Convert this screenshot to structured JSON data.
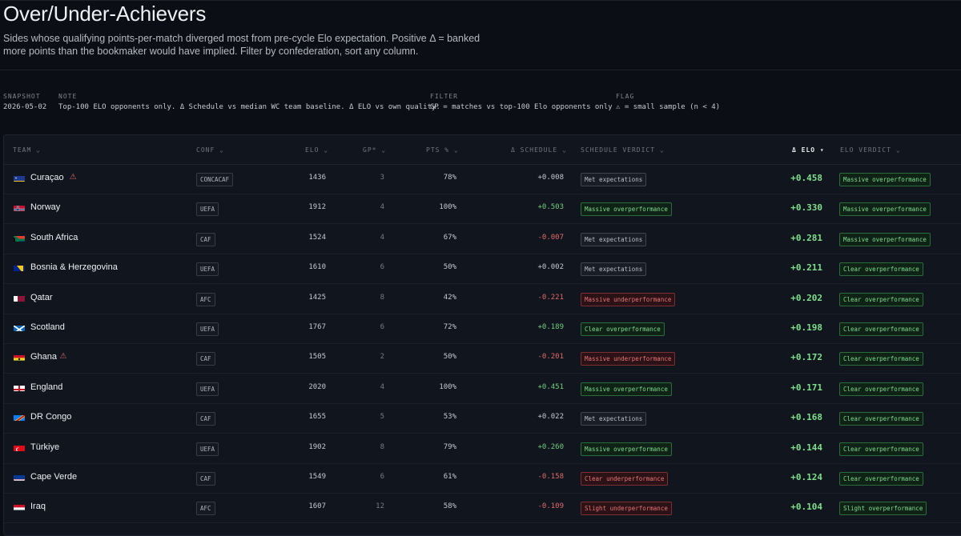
{
  "header": {
    "title": "Over/Under-Achievers",
    "subtitle": "Sides whose qualifying points-per-match diverged most from pre-cycle Elo expectation. Positive Δ = banked more points than the bookmaker would have implied. Filter by confederation, sort any column."
  },
  "meta": {
    "snapshot_label": "SNAPSHOT",
    "snapshot_value": "2026-05-02",
    "note_label": "NOTE",
    "note_value": "Top-100 ELO opponents only. Δ Schedule vs median WC team baseline. Δ ELO vs own quality.",
    "filter_label": "FILTER",
    "filter_value": "GP = matches vs top-100 Elo opponents only",
    "flag_label": "FLAG",
    "flag_value": "⚠ = small sample (n < 4)"
  },
  "columns": {
    "team": "TEAM",
    "conf": "CONF",
    "elo": "ELO",
    "gp": "GP*",
    "pts": "PTS %",
    "d_schedule": "Δ SCHEDULE",
    "schedule_verdict": "SCHEDULE VERDICT",
    "d_elo": "Δ ELO",
    "elo_verdict": "ELO VERDICT",
    "sort_glyph": "⌄",
    "active_sort_glyph": "▾"
  },
  "colors": {
    "background": "#0b0e14",
    "positive": "#6fcf7f",
    "negative": "#e06a6a",
    "warning": "#e06666"
  },
  "rows": [
    {
      "team": "Curaçao",
      "flag": "curacao-flag",
      "warn": "⚠",
      "conf": "CONCACAF",
      "elo": "1436",
      "gp": "3",
      "pts": "78%",
      "d_schedule": "+0.008",
      "schedule_verdict": "Met expectations",
      "schedule_tone": "gray",
      "d_elo": "+0.458",
      "elo_verdict": "Massive overperformance"
    },
    {
      "team": "Norway",
      "flag": "norway-flag",
      "warn": "",
      "conf": "UEFA",
      "elo": "1912",
      "gp": "4",
      "pts": "100%",
      "d_schedule": "+0.503",
      "schedule_verdict": "Massive overperformance",
      "schedule_tone": "green",
      "d_elo": "+0.330",
      "elo_verdict": "Massive overperformance"
    },
    {
      "team": "South Africa",
      "flag": "south-africa-flag",
      "warn": "",
      "conf": "CAF",
      "elo": "1524",
      "gp": "4",
      "pts": "67%",
      "d_schedule": "-0.007",
      "schedule_verdict": "Met expectations",
      "schedule_tone": "gray",
      "d_elo": "+0.281",
      "elo_verdict": "Massive overperformance"
    },
    {
      "team": "Bosnia & Herzegovina",
      "flag": "bosnia-flag",
      "warn": "",
      "conf": "UEFA",
      "elo": "1610",
      "gp": "6",
      "pts": "50%",
      "d_schedule": "+0.002",
      "schedule_verdict": "Met expectations",
      "schedule_tone": "gray",
      "d_elo": "+0.211",
      "elo_verdict": "Clear overperformance"
    },
    {
      "team": "Qatar",
      "flag": "qatar-flag",
      "warn": "",
      "conf": "AFC",
      "elo": "1425",
      "gp": "8",
      "pts": "42%",
      "d_schedule": "-0.221",
      "schedule_verdict": "Massive underperformance",
      "schedule_tone": "red",
      "d_elo": "+0.202",
      "elo_verdict": "Clear overperformance"
    },
    {
      "team": "Scotland",
      "flag": "scotland-flag",
      "warn": "",
      "conf": "UEFA",
      "elo": "1767",
      "gp": "6",
      "pts": "72%",
      "d_schedule": "+0.189",
      "schedule_verdict": "Clear overperformance",
      "schedule_tone": "green",
      "d_elo": "+0.198",
      "elo_verdict": "Clear overperformance"
    },
    {
      "team": "Ghana",
      "flag": "ghana-flag",
      "warn": "⚠",
      "conf": "CAF",
      "elo": "1505",
      "gp": "2",
      "pts": "50%",
      "d_schedule": "-0.201",
      "schedule_verdict": "Massive underperformance",
      "schedule_tone": "red",
      "d_elo": "+0.172",
      "elo_verdict": "Clear overperformance"
    },
    {
      "team": "England",
      "flag": "england-flag",
      "warn": "",
      "conf": "UEFA",
      "elo": "2020",
      "gp": "4",
      "pts": "100%",
      "d_schedule": "+0.451",
      "schedule_verdict": "Massive overperformance",
      "schedule_tone": "green",
      "d_elo": "+0.171",
      "elo_verdict": "Clear overperformance"
    },
    {
      "team": "DR Congo",
      "flag": "dr-congo-flag",
      "warn": "",
      "conf": "CAF",
      "elo": "1655",
      "gp": "5",
      "pts": "53%",
      "d_schedule": "+0.022",
      "schedule_verdict": "Met expectations",
      "schedule_tone": "gray",
      "d_elo": "+0.168",
      "elo_verdict": "Clear overperformance"
    },
    {
      "team": "Türkiye",
      "flag": "turkiye-flag",
      "warn": "",
      "conf": "UEFA",
      "elo": "1902",
      "gp": "8",
      "pts": "79%",
      "d_schedule": "+0.260",
      "schedule_verdict": "Massive overperformance",
      "schedule_tone": "green",
      "d_elo": "+0.144",
      "elo_verdict": "Clear overperformance"
    },
    {
      "team": "Cape Verde",
      "flag": "cape-verde-flag",
      "warn": "",
      "conf": "CAF",
      "elo": "1549",
      "gp": "6",
      "pts": "61%",
      "d_schedule": "-0.158",
      "schedule_verdict": "Clear underperformance",
      "schedule_tone": "red",
      "d_elo": "+0.124",
      "elo_verdict": "Clear overperformance"
    },
    {
      "team": "Iraq",
      "flag": "iraq-flag",
      "warn": "",
      "conf": "AFC",
      "elo": "1607",
      "gp": "12",
      "pts": "58%",
      "d_schedule": "-0.109",
      "schedule_verdict": "Slight underperformance",
      "schedule_tone": "red",
      "d_elo": "+0.104",
      "elo_verdict": "Slight overperformance"
    }
  ]
}
